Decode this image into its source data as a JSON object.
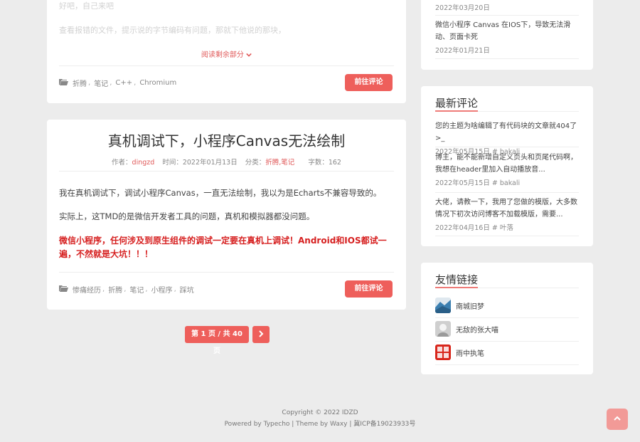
{
  "post1": {
    "faded_line1": "好吧，自己来吧",
    "faded_line2": "查看报错的文件，提示说的字节编码有问题，那就下他说的那块，",
    "read_more": "阅读剩余部分",
    "tags": [
      "折腾",
      "笔记",
      "C++",
      "Chromium"
    ],
    "comment_button": "前往评论"
  },
  "post2": {
    "title": "真机调试下，小程序Canvas无法绘制",
    "meta": {
      "author_label": "作者：",
      "author": "dingzd",
      "time_label": "时间：",
      "time": "2022年01月13日",
      "category_label": "分类：",
      "category": "折腾,笔记",
      "words_label": "字数：",
      "words": "162"
    },
    "para1": "我在真机调试下，调试小程序Canvas，一直无法绘制，我以为是Echarts不兼容导致的。",
    "para2": "实际上，这TMD的是微信开发者工具的问题，真机和模拟器都没问题。",
    "warning": "微信小程序，任何涉及到原生组件的调试一定要在真机上调试！Android和IOS都试一遍，不然就是大坑！！！",
    "tags": [
      "惨痛经历",
      "折腾",
      "笔记",
      "小程序",
      "踩坑"
    ],
    "comment_button": "前往评论"
  },
  "pagination": {
    "page_info": "第 1 页 / 共 40 页"
  },
  "sidebar": {
    "recent": {
      "item1_date": "2022年03月20日",
      "item2_title": "微信小程序 Canvas 在IOS下，导致无法滑动、页面卡死",
      "item2_date": "2022年01月21日"
    },
    "comments": {
      "title": "最新评论",
      "items": [
        {
          "text": "您的主题为啥编辑了有代码块的文章就404了>_",
          "sub": "2022年05月15日 # bakali"
        },
        {
          "text": "博主，能不能新增自定义页头和页尾代码啊，我想在header里加入自动播放音...",
          "sub": "2022年05月15日 # bakali"
        },
        {
          "text": "大佬，请教一下，我用了您做的模版，大多数情况下初次访问博客不加载模版，需要...",
          "sub": "2022年04月16日 # 叶落"
        }
      ]
    },
    "links": {
      "title": "友情链接",
      "items": [
        {
          "name": "南城旧梦"
        },
        {
          "name": "无敌的张大喵"
        },
        {
          "name": "雨中执笔"
        }
      ]
    }
  },
  "footer": {
    "copyright": "Copyright © 2022 IDZD",
    "powered": "Powered by Typecho | Theme by Waxy | 冀ICP备19023933号"
  },
  "colors": {
    "accent": "#ee5f5b",
    "warning_text": "#d61f1f",
    "background": "#ececec"
  }
}
